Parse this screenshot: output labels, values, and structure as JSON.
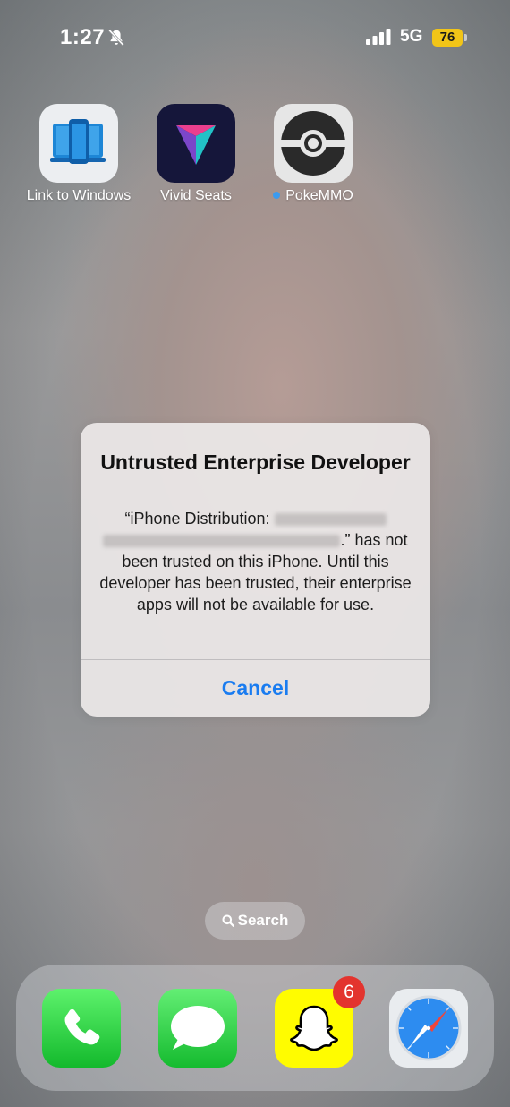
{
  "status_bar": {
    "time": "1:27",
    "network": "5G",
    "battery": "76",
    "silent_icon": "bell-slash-icon",
    "signal_icon": "cellular-signal-icon"
  },
  "home_apps": [
    {
      "label": "Link to Windows",
      "icon": "link-to-windows-icon"
    },
    {
      "label": "Vivid Seats",
      "icon": "vivid-seats-icon"
    },
    {
      "label": "PokeMMO",
      "icon": "pokemmo-icon",
      "new_dot": true
    }
  ],
  "alert": {
    "title": "Untrusted Enterprise Developer",
    "message_prefix": "“iPhone Distribution: ",
    "message_suffix": ".” has not been trusted on this iPhone. Until this developer has been trusted, their enterprise apps will not be available for use.",
    "cancel_label": "Cancel"
  },
  "search": {
    "label": "Search",
    "icon": "magnifying-glass-icon"
  },
  "dock": [
    {
      "app": "Phone",
      "icon": "phone-icon"
    },
    {
      "app": "Messages",
      "icon": "messages-icon"
    },
    {
      "app": "Snapchat",
      "icon": "snapchat-ghost-icon",
      "badge": "6"
    },
    {
      "app": "Safari",
      "icon": "safari-compass-icon"
    }
  ],
  "colors": {
    "accent_blue": "#1a7cf0",
    "battery_yellow": "#f2c518",
    "badge_red": "#e3342e"
  }
}
